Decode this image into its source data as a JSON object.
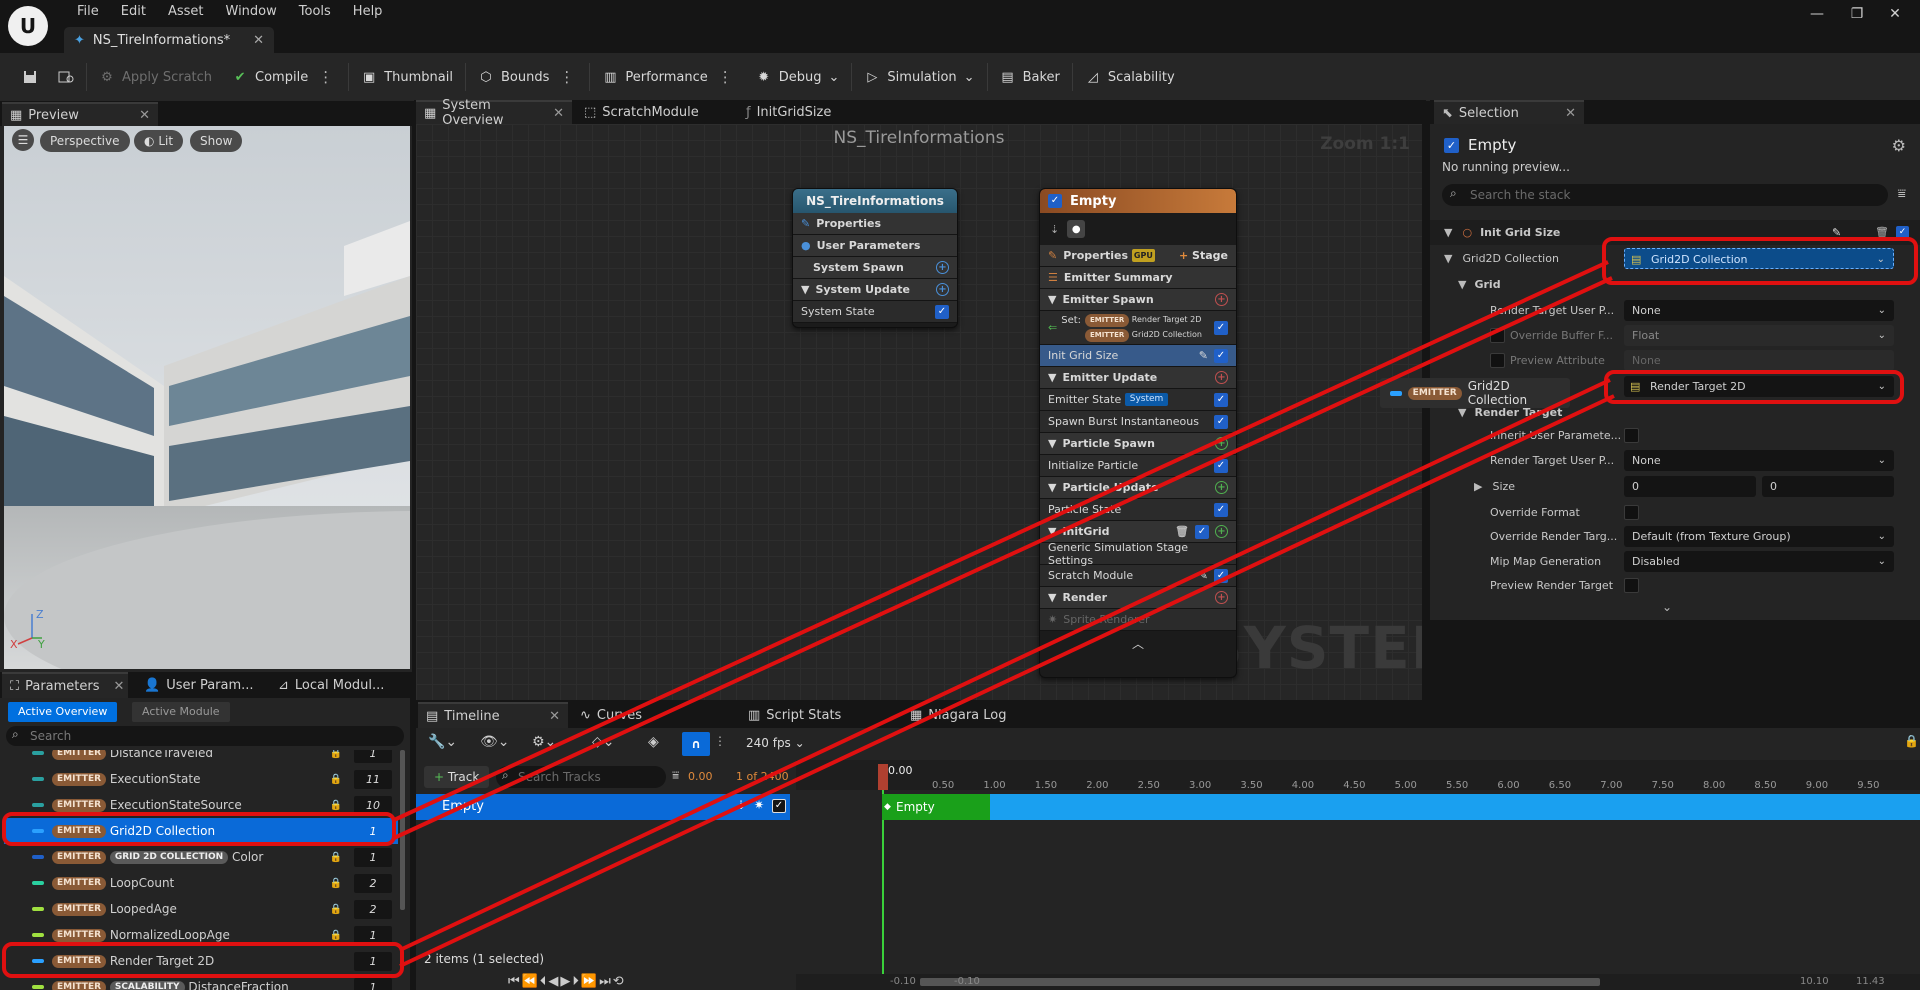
{
  "app": {
    "logo": "unreal-logo",
    "menu": [
      "File",
      "Edit",
      "Asset",
      "Window",
      "Tools",
      "Help"
    ],
    "asset_tab": "NS_TireInformations*"
  },
  "toolbar": {
    "apply_scratch": "Apply Scratch",
    "compile": "Compile",
    "thumbnail": "Thumbnail",
    "bounds": "Bounds",
    "performance": "Performance",
    "debug": "Debug",
    "simulation": "Simulation",
    "baker": "Baker",
    "scalability": "Scalability"
  },
  "preview": {
    "tab": "Preview",
    "perspective": "Perspective",
    "lit": "Lit",
    "show": "Show",
    "axis_z": "Z",
    "axis_x": "X",
    "axis_y": "Y"
  },
  "graph": {
    "tabs": [
      "System Overview",
      "ScratchModule",
      "InitGridSize"
    ],
    "title": "NS_TireInformations",
    "zoom": "Zoom 1:1",
    "watermark": "SYSTEM",
    "system_node": {
      "title": "NS_TireInformations",
      "rows": [
        "Properties",
        "User Parameters",
        "System Spawn",
        "System Update",
        "System State"
      ]
    },
    "emitter_node": {
      "title": "Empty",
      "properties": "Properties",
      "gpu": "GPU",
      "stage": "Stage",
      "summary": "Emitter Summary",
      "emitter_spawn": "Emitter Spawn",
      "set_label": "Set:",
      "set_badge": "EMITTER",
      "set_item1": "Render Target 2D",
      "set_item2": "Grid2D Collection",
      "init_grid_size": "Init Grid Size",
      "emitter_update": "Emitter Update",
      "emitter_state": "Emitter State",
      "emitter_state_tag": "System",
      "spawn_burst": "Spawn Burst Instantaneous",
      "particle_spawn": "Particle Spawn",
      "initialize_particle": "Initialize Particle",
      "particle_update": "Particle Update",
      "particle_state": "Particle State",
      "initgrid": "InitGrid",
      "generic_sim": "Generic Simulation Stage Settings",
      "scratch_module": "Scratch Module",
      "render": "Render",
      "sprite_renderer": "Sprite Renderer"
    }
  },
  "selection": {
    "tab": "Selection",
    "emitter_name": "Empty",
    "no_preview": "No running preview...",
    "search_placeholder": "Search the stack",
    "init_grid_size": "Init Grid Size",
    "grid2d_collection": "Grid2D Collection",
    "grid2d_value": "Grid2D Collection",
    "grid": "Grid",
    "render_target_user_p": "Render Target User P...",
    "none": "None",
    "override_buffer": "Override Buffer F...",
    "float": "Float",
    "preview_attribute": "Preview Attribute",
    "preview_attr_value": "None",
    "render_target_2d_value": "Render Target 2D",
    "render_target_cat": "Render Target",
    "inherit_user": "Inherit User Paramete...",
    "rt_user_p": "Render Target User P...",
    "rt_user_value": "None",
    "size": "Size",
    "size_x": "0",
    "size_y": "0",
    "override_format": "Override Format",
    "override_render_targ": "Override Render Targ...",
    "override_render_value": "Default (from Texture Group)",
    "mip_map": "Mip Map Generation",
    "mip_value": "Disabled",
    "preview_render_target": "Preview Render Target",
    "tooltip_badge": "EMITTER",
    "tooltip_text": "Grid2D Collection"
  },
  "parameters": {
    "tabs": [
      "Parameters",
      "User Param...",
      "Local Modul..."
    ],
    "active_overview": "Active Overview",
    "active_module": "Active Module",
    "search_placeholder": "Search",
    "badge": "EMITTER",
    "rows": [
      {
        "name": "DistanceTraveled",
        "count": "1",
        "color": "#2aa0a0"
      },
      {
        "name": "ExecutionState",
        "count": "11",
        "color": "#2aa0a0"
      },
      {
        "name": "ExecutionStateSource",
        "count": "10",
        "color": "#2aa0a0"
      },
      {
        "name": "Grid2D Collection",
        "count": "1",
        "color": "#2aa0ff"
      },
      {
        "name": "Color",
        "count": "1",
        "color": "#2060c8",
        "extra_badge": "GRID 2D COLLECTION"
      },
      {
        "name": "LoopCount",
        "count": "2",
        "color": "#2ad0a0"
      },
      {
        "name": "LoopedAge",
        "count": "2",
        "color": "#a0e040"
      },
      {
        "name": "NormalizedLoopAge",
        "count": "1",
        "color": "#a0e040"
      },
      {
        "name": "Render Target 2D",
        "count": "1",
        "color": "#2aa0ff"
      },
      {
        "name": "DistanceFraction",
        "count": "1",
        "color": "#a0e040",
        "extra_badge": "SCALABILITY"
      }
    ]
  },
  "timeline": {
    "tabs": [
      "Timeline",
      "Curves",
      "Script Stats",
      "Niagara Log"
    ],
    "fps": "240 fps",
    "track_button": "Track",
    "search_tracks": "Search Tracks",
    "time_current": "0.00",
    "frame_info": "1 of 2400",
    "track_name": "Empty",
    "clip_name": "Empty",
    "playhead": "0.00",
    "ticks": [
      "0.50",
      "1.00",
      "1.50",
      "2.00",
      "2.50",
      "3.00",
      "3.50",
      "4.00",
      "4.50",
      "5.00",
      "5.50",
      "6.00",
      "6.50",
      "7.00",
      "7.50",
      "8.00",
      "8.50",
      "9.00",
      "9.50"
    ],
    "status": "2 items (1 selected)",
    "range_start": "-0.10",
    "range_start2": "-0.10",
    "range_end": "10.10",
    "range_end2": "11.43"
  }
}
